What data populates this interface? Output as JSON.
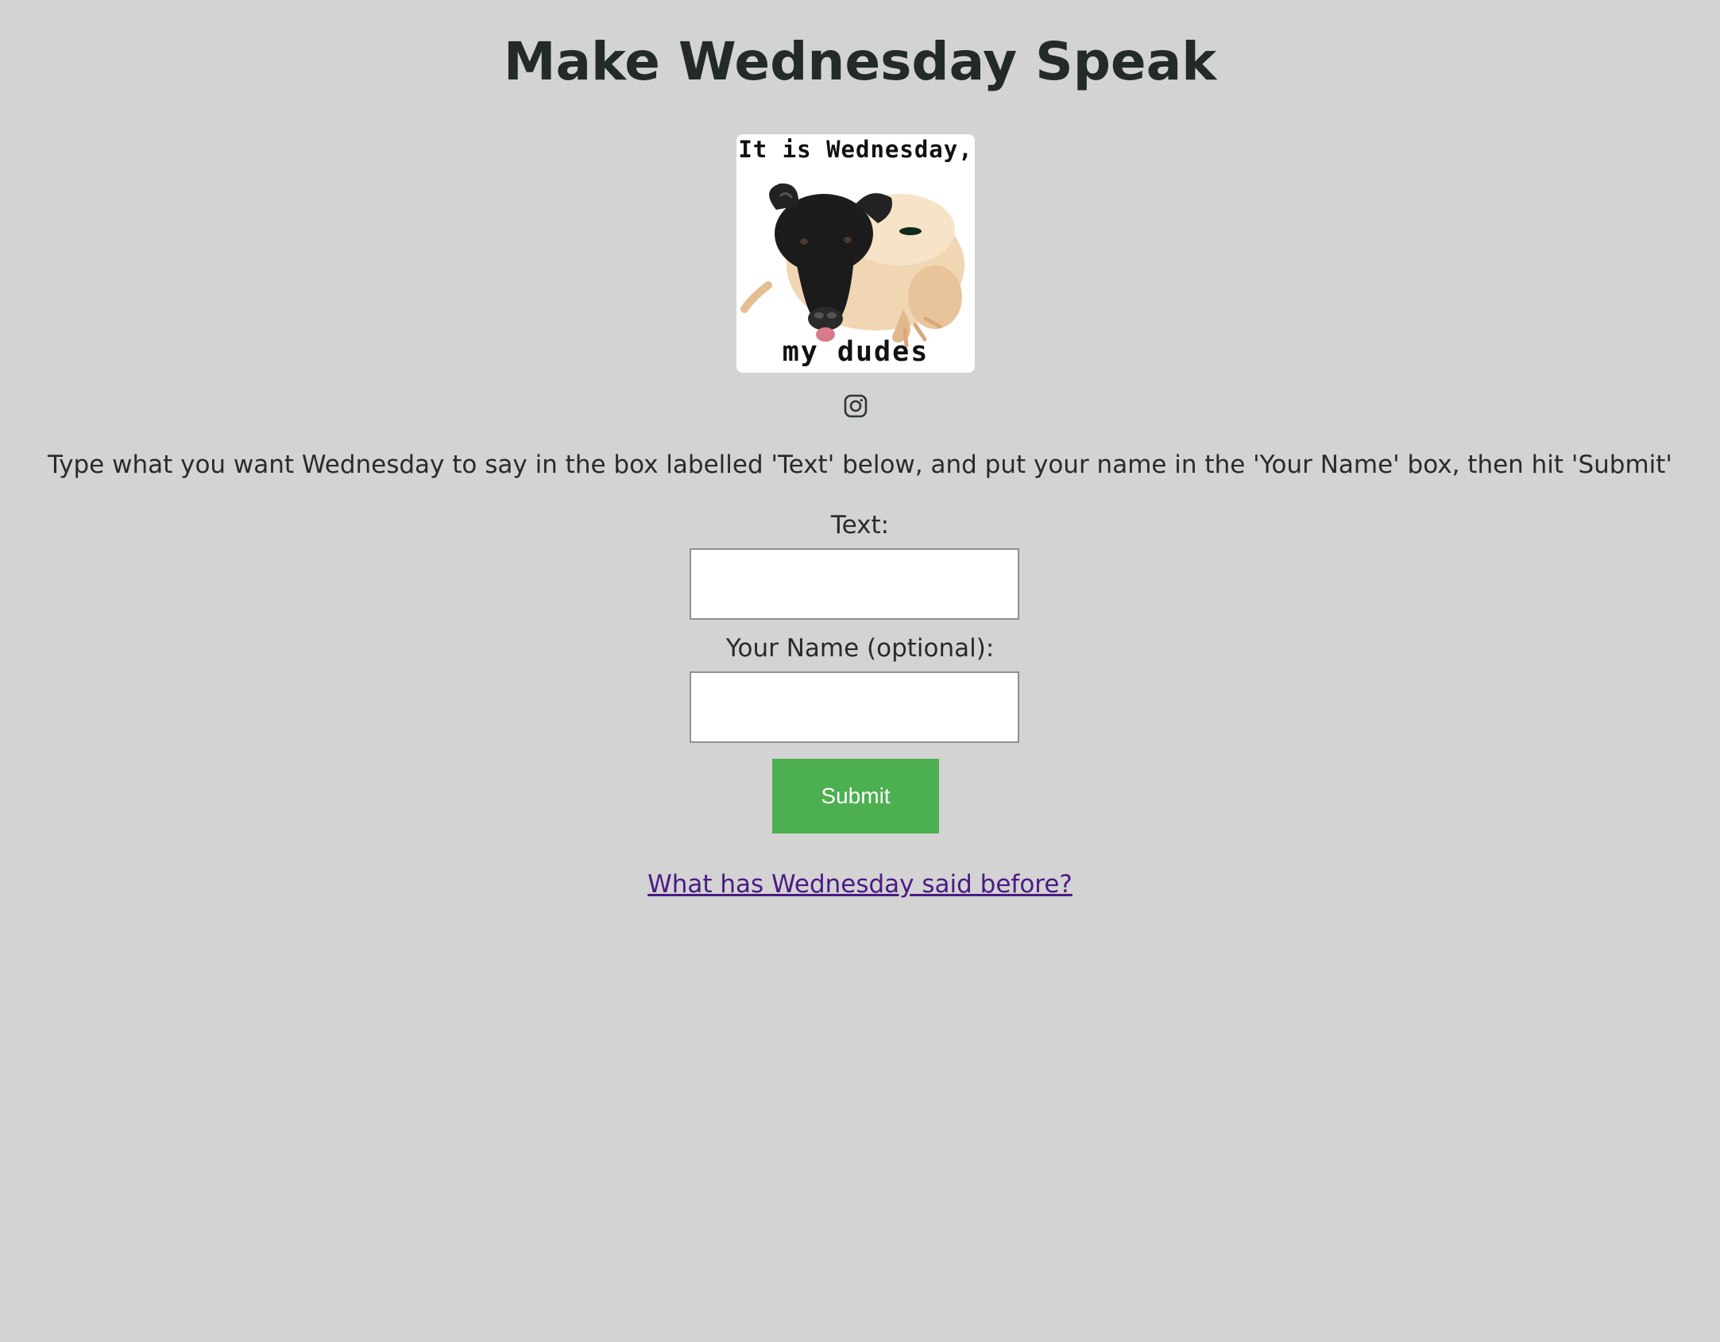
{
  "page": {
    "title": "Make Wednesday Speak",
    "background_color": "#d3d3d3"
  },
  "meme": {
    "top_caption": "It is Wednesday,",
    "bottom_caption": "my dudes"
  },
  "social": {
    "icon": "instagram-icon"
  },
  "instructions": "Type what you want Wednesday to say in the box labelled 'Text' below, and put your name in the 'Your Name' box, then hit 'Submit'",
  "form": {
    "text_label": "Text:",
    "text_value": "",
    "name_label": "Your Name (optional):",
    "name_value": "",
    "submit_label": "Submit",
    "submit_color": "#4caf50"
  },
  "history_link": {
    "label": "What has Wednesday said before?",
    "color": "#4b1a85"
  }
}
